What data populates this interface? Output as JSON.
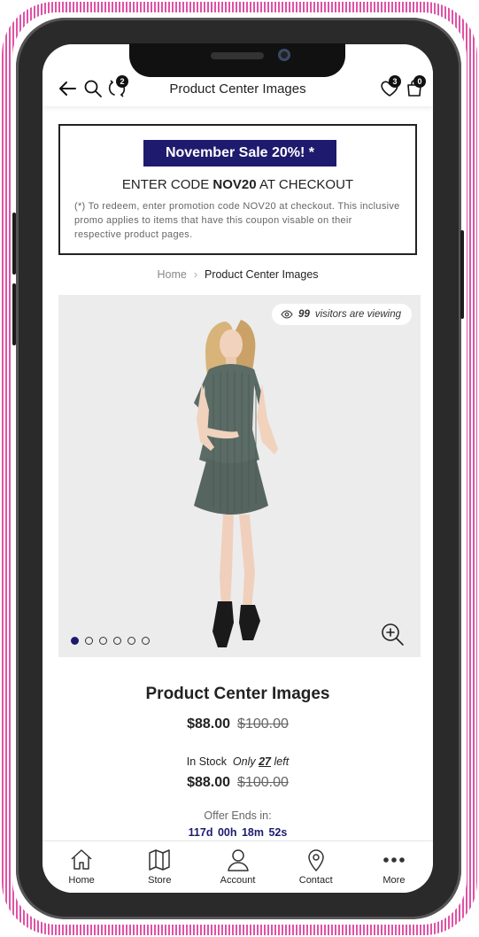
{
  "header": {
    "title": "Product Center Images",
    "compare_count": "2",
    "wishlist_count": "3",
    "cart_count": "0"
  },
  "promo": {
    "sale_label": "November Sale 20%! *",
    "code_prefix": "ENTER CODE ",
    "code": "NOV20",
    "code_suffix": " AT CHECKOUT",
    "note": "(*) To redeem, enter promotion code NOV20 at checkout. This inclusive promo applies to items that have this coupon visable on their respective product pages."
  },
  "breadcrumb": {
    "home": "Home",
    "current": "Product Center Images"
  },
  "gallery": {
    "viewers_count": "99",
    "viewers_text": "visitors are viewing",
    "image_count": 6,
    "active_index": 0
  },
  "product": {
    "name": "Product Center Images",
    "price": "$88.00",
    "compare_price": "$100.00",
    "stock_label": "In Stock",
    "stock_only": "Only",
    "stock_qty": "27",
    "stock_left": "left",
    "price2": "$88.00",
    "compare_price2": "$100.00",
    "offer_label": "Offer Ends in:",
    "timer": "117d 00h 18m 52s"
  },
  "nav": {
    "items": [
      {
        "label": "Home",
        "icon": "home-icon"
      },
      {
        "label": "Store",
        "icon": "map-icon"
      },
      {
        "label": "Account",
        "icon": "user-icon"
      },
      {
        "label": "Contact",
        "icon": "location-pin-icon"
      },
      {
        "label": "More",
        "icon": "more-dots-icon"
      }
    ]
  },
  "colors": {
    "frame_accent": "#e052a6",
    "brand_navy": "#1e1b6e"
  }
}
